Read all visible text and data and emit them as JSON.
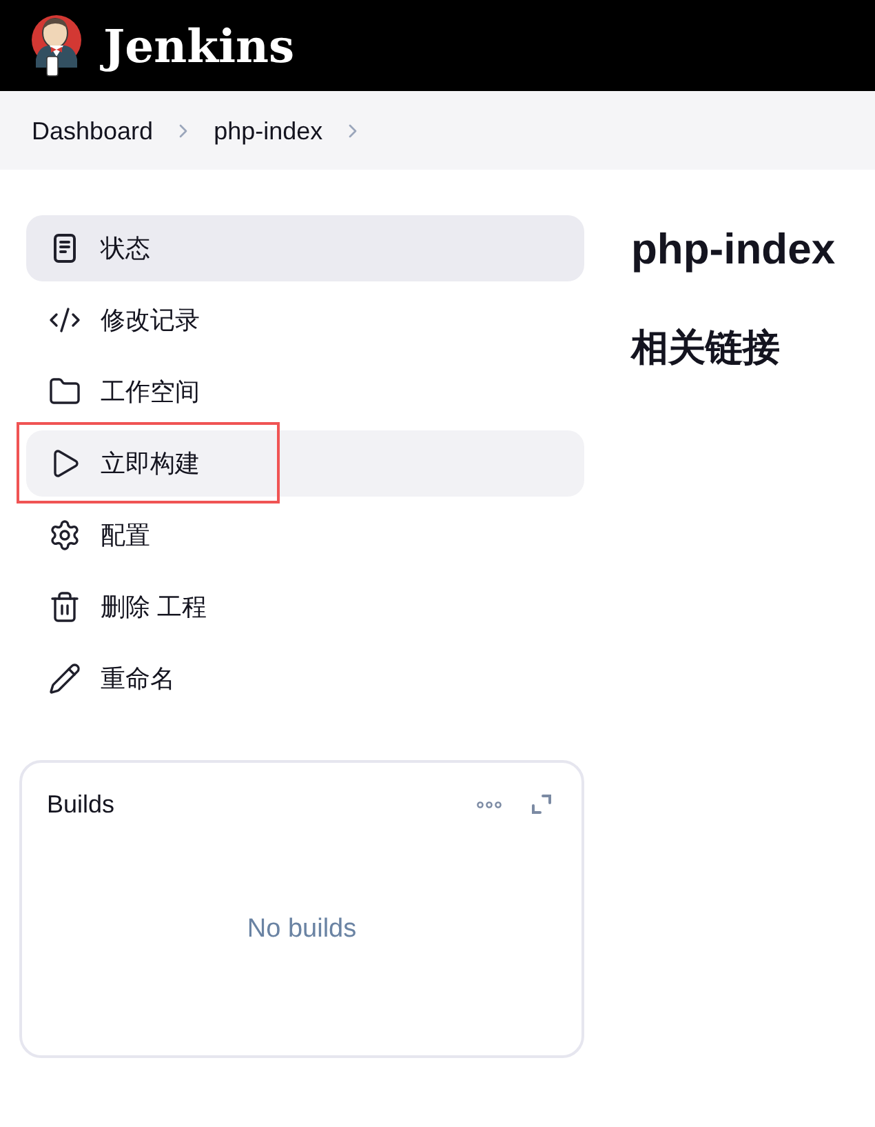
{
  "header": {
    "title": "Jenkins"
  },
  "breadcrumb": [
    {
      "label": "Dashboard"
    },
    {
      "label": "php-index"
    }
  ],
  "sidebar": {
    "items": [
      {
        "label": "状态",
        "selected": true,
        "hovered": false,
        "highlighted": false
      },
      {
        "label": "修改记录",
        "selected": false,
        "hovered": false,
        "highlighted": false
      },
      {
        "label": "工作空间",
        "selected": false,
        "hovered": false,
        "highlighted": false
      },
      {
        "label": "立即构建",
        "selected": false,
        "hovered": true,
        "highlighted": true
      },
      {
        "label": "配置",
        "selected": false,
        "hovered": false,
        "highlighted": false
      },
      {
        "label": "删除 工程",
        "selected": false,
        "hovered": false,
        "highlighted": false
      },
      {
        "label": "重命名",
        "selected": false,
        "hovered": false,
        "highlighted": false
      }
    ]
  },
  "builds": {
    "title": "Builds",
    "empty_message": "No builds"
  },
  "main": {
    "title": "php-index",
    "section_title": "相关链接"
  }
}
